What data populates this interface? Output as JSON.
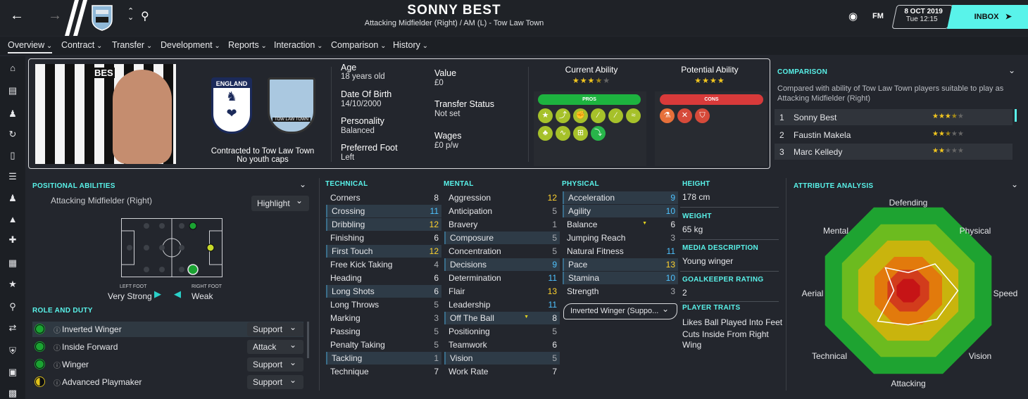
{
  "header": {
    "player_name": "SONNY BEST",
    "subtitle": "Attacking Midfielder (Right) / AM (L) - Tow Law Town",
    "date": "8 OCT 2019",
    "time": "Tue 12:15",
    "fm_label": "FM",
    "inbox_label": "INBOX"
  },
  "menu": {
    "items": [
      "Overview",
      "Contract",
      "Transfer",
      "Development",
      "Reports",
      "Interaction",
      "Comparison",
      "History"
    ]
  },
  "profile": {
    "shirt_text": "BES",
    "contract_line1": "Contracted to Tow Law Town",
    "contract_line2": "No youth caps",
    "england_crest_text": "ENGLAND",
    "club_crest_text": "TOW LAW TOWN",
    "age_label": "Age",
    "age_value": "18 years old",
    "dob_label": "Date Of Birth",
    "dob_value": "14/10/2000",
    "personality_label": "Personality",
    "personality_value": "Balanced",
    "foot_label": "Preferred Foot",
    "foot_value": "Left",
    "value_label": "Value",
    "value_value": "£0",
    "transfer_label": "Transfer Status",
    "transfer_value": "Not set",
    "wages_label": "Wages",
    "wages_value": "£0 p/w",
    "current_ability_label": "Current Ability",
    "current_ability_stars": 3.5,
    "potential_ability_label": "Potential Ability",
    "potential_ability_stars": 4,
    "pros_label": "PROS",
    "cons_label": "CONS"
  },
  "comparison": {
    "title": "COMPARISON",
    "description": "Compared with ability of Tow Law Town players suitable to play as Attacking Midfielder (Right)",
    "rows": [
      {
        "rank": "1",
        "name": "Sonny Best",
        "stars": 3.5
      },
      {
        "rank": "2",
        "name": "Faustin Makela",
        "stars": 2.5
      },
      {
        "rank": "3",
        "name": "Marc Kelledy",
        "stars": 2
      }
    ]
  },
  "positional": {
    "title": "POSITIONAL ABILITIES",
    "position": "Attacking Midfielder (Right)",
    "highlight_label": "Highlight",
    "left_foot_label": "LEFT FOOT",
    "left_foot_value": "Very Strong",
    "right_foot_label": "RIGHT FOOT",
    "right_foot_value": "Weak"
  },
  "roles": {
    "title": "ROLE AND DUTY",
    "items": [
      {
        "name": "Inverted Winger",
        "duty": "Support"
      },
      {
        "name": "Inside Forward",
        "duty": "Attack"
      },
      {
        "name": "Winger",
        "duty": "Support"
      },
      {
        "name": "Advanced Playmaker",
        "duty": "Support"
      }
    ]
  },
  "technical": {
    "title": "TECHNICAL",
    "attrs": [
      {
        "name": "Corners",
        "value": "8"
      },
      {
        "name": "Crossing",
        "value": "11"
      },
      {
        "name": "Dribbling",
        "value": "12"
      },
      {
        "name": "Finishing",
        "value": "6"
      },
      {
        "name": "First Touch",
        "value": "12"
      },
      {
        "name": "Free Kick Taking",
        "value": "4"
      },
      {
        "name": "Heading",
        "value": "6"
      },
      {
        "name": "Long Shots",
        "value": "6"
      },
      {
        "name": "Long Throws",
        "value": "5"
      },
      {
        "name": "Marking",
        "value": "3"
      },
      {
        "name": "Passing",
        "value": "5"
      },
      {
        "name": "Penalty Taking",
        "value": "5"
      },
      {
        "name": "Tackling",
        "value": "1"
      },
      {
        "name": "Technique",
        "value": "7"
      }
    ]
  },
  "mental": {
    "title": "MENTAL",
    "attrs": [
      {
        "name": "Aggression",
        "value": "12"
      },
      {
        "name": "Anticipation",
        "value": "5"
      },
      {
        "name": "Bravery",
        "value": "1"
      },
      {
        "name": "Composure",
        "value": "5"
      },
      {
        "name": "Concentration",
        "value": "5"
      },
      {
        "name": "Decisions",
        "value": "9"
      },
      {
        "name": "Determination",
        "value": "11"
      },
      {
        "name": "Flair",
        "value": "13"
      },
      {
        "name": "Leadership",
        "value": "11"
      },
      {
        "name": "Off The Ball",
        "value": "8"
      },
      {
        "name": "Positioning",
        "value": "5"
      },
      {
        "name": "Teamwork",
        "value": "6"
      },
      {
        "name": "Vision",
        "value": "5"
      },
      {
        "name": "Work Rate",
        "value": "7"
      }
    ]
  },
  "physical": {
    "title": "PHYSICAL",
    "attrs": [
      {
        "name": "Acceleration",
        "value": "9"
      },
      {
        "name": "Agility",
        "value": "10"
      },
      {
        "name": "Balance",
        "value": "6"
      },
      {
        "name": "Jumping Reach",
        "value": "3"
      },
      {
        "name": "Natural Fitness",
        "value": "11"
      },
      {
        "name": "Pace",
        "value": "13"
      },
      {
        "name": "Stamina",
        "value": "10"
      },
      {
        "name": "Strength",
        "value": "3"
      }
    ],
    "role_select": "Inverted Winger (Suppo..."
  },
  "info": {
    "height_label": "HEIGHT",
    "height_value": "178 cm",
    "weight_label": "WEIGHT",
    "weight_value": "65 kg",
    "media_label": "MEDIA DESCRIPTION",
    "media_value": "Young winger",
    "gk_label": "GOALKEEPER RATING",
    "gk_value": "2",
    "traits_label": "PLAYER TRAITS",
    "trait1": "Likes Ball Played Into Feet",
    "trait2": "Cuts Inside From Right Wing"
  },
  "analysis": {
    "title": "ATTRIBUTE ANALYSIS",
    "axes": [
      "Defending",
      "Physical",
      "Speed",
      "Vision",
      "Attacking",
      "Technical",
      "Aerial",
      "Mental"
    ],
    "colors": {
      "ring1": "#1ea331",
      "ring2": "#6cbb1f",
      "ring3": "#c9b40d",
      "ring4": "#e27a0c",
      "ring5": "#d23c1c",
      "core": "#c61416"
    }
  },
  "colors": {
    "accent": "#59f3ea",
    "pros": "#1db33f",
    "cons": "#d83a3a",
    "highlight_row": "#2e3b47"
  }
}
